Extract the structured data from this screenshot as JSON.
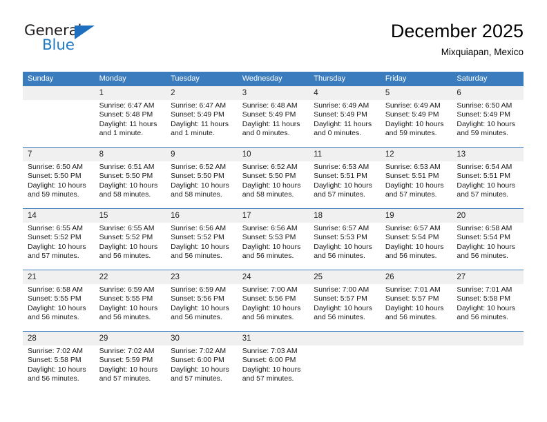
{
  "brand": {
    "name_top": "General",
    "name_bottom": "Blue",
    "triangle_color": "#1f6fc0",
    "blue_color": "#1f7ac6"
  },
  "header": {
    "title": "December 2025",
    "subtitle": "Mixquiapan, Mexico"
  },
  "theme": {
    "header_bg": "#3b7cbf",
    "header_text": "#ffffff",
    "daynum_bg": "#f0f0f0",
    "rule_color": "#3b7cbf"
  },
  "weekday_headers": [
    "Sunday",
    "Monday",
    "Tuesday",
    "Wednesday",
    "Thursday",
    "Friday",
    "Saturday"
  ],
  "labels": {
    "sunrise": "Sunrise:",
    "sunset": "Sunset:",
    "daylight": "Daylight:"
  },
  "weeks": [
    [
      {
        "day": "",
        "sunrise": "",
        "sunset": "",
        "daylight_1": "",
        "daylight_2": ""
      },
      {
        "day": "1",
        "sunrise": "Sunrise: 6:47 AM",
        "sunset": "Sunset: 5:48 PM",
        "daylight_1": "Daylight: 11 hours",
        "daylight_2": "and 1 minute."
      },
      {
        "day": "2",
        "sunrise": "Sunrise: 6:47 AM",
        "sunset": "Sunset: 5:49 PM",
        "daylight_1": "Daylight: 11 hours",
        "daylight_2": "and 1 minute."
      },
      {
        "day": "3",
        "sunrise": "Sunrise: 6:48 AM",
        "sunset": "Sunset: 5:49 PM",
        "daylight_1": "Daylight: 11 hours",
        "daylight_2": "and 0 minutes."
      },
      {
        "day": "4",
        "sunrise": "Sunrise: 6:49 AM",
        "sunset": "Sunset: 5:49 PM",
        "daylight_1": "Daylight: 11 hours",
        "daylight_2": "and 0 minutes."
      },
      {
        "day": "5",
        "sunrise": "Sunrise: 6:49 AM",
        "sunset": "Sunset: 5:49 PM",
        "daylight_1": "Daylight: 10 hours",
        "daylight_2": "and 59 minutes."
      },
      {
        "day": "6",
        "sunrise": "Sunrise: 6:50 AM",
        "sunset": "Sunset: 5:49 PM",
        "daylight_1": "Daylight: 10 hours",
        "daylight_2": "and 59 minutes."
      }
    ],
    [
      {
        "day": "7",
        "sunrise": "Sunrise: 6:50 AM",
        "sunset": "Sunset: 5:50 PM",
        "daylight_1": "Daylight: 10 hours",
        "daylight_2": "and 59 minutes."
      },
      {
        "day": "8",
        "sunrise": "Sunrise: 6:51 AM",
        "sunset": "Sunset: 5:50 PM",
        "daylight_1": "Daylight: 10 hours",
        "daylight_2": "and 58 minutes."
      },
      {
        "day": "9",
        "sunrise": "Sunrise: 6:52 AM",
        "sunset": "Sunset: 5:50 PM",
        "daylight_1": "Daylight: 10 hours",
        "daylight_2": "and 58 minutes."
      },
      {
        "day": "10",
        "sunrise": "Sunrise: 6:52 AM",
        "sunset": "Sunset: 5:50 PM",
        "daylight_1": "Daylight: 10 hours",
        "daylight_2": "and 58 minutes."
      },
      {
        "day": "11",
        "sunrise": "Sunrise: 6:53 AM",
        "sunset": "Sunset: 5:51 PM",
        "daylight_1": "Daylight: 10 hours",
        "daylight_2": "and 57 minutes."
      },
      {
        "day": "12",
        "sunrise": "Sunrise: 6:53 AM",
        "sunset": "Sunset: 5:51 PM",
        "daylight_1": "Daylight: 10 hours",
        "daylight_2": "and 57 minutes."
      },
      {
        "day": "13",
        "sunrise": "Sunrise: 6:54 AM",
        "sunset": "Sunset: 5:51 PM",
        "daylight_1": "Daylight: 10 hours",
        "daylight_2": "and 57 minutes."
      }
    ],
    [
      {
        "day": "14",
        "sunrise": "Sunrise: 6:55 AM",
        "sunset": "Sunset: 5:52 PM",
        "daylight_1": "Daylight: 10 hours",
        "daylight_2": "and 57 minutes."
      },
      {
        "day": "15",
        "sunrise": "Sunrise: 6:55 AM",
        "sunset": "Sunset: 5:52 PM",
        "daylight_1": "Daylight: 10 hours",
        "daylight_2": "and 56 minutes."
      },
      {
        "day": "16",
        "sunrise": "Sunrise: 6:56 AM",
        "sunset": "Sunset: 5:52 PM",
        "daylight_1": "Daylight: 10 hours",
        "daylight_2": "and 56 minutes."
      },
      {
        "day": "17",
        "sunrise": "Sunrise: 6:56 AM",
        "sunset": "Sunset: 5:53 PM",
        "daylight_1": "Daylight: 10 hours",
        "daylight_2": "and 56 minutes."
      },
      {
        "day": "18",
        "sunrise": "Sunrise: 6:57 AM",
        "sunset": "Sunset: 5:53 PM",
        "daylight_1": "Daylight: 10 hours",
        "daylight_2": "and 56 minutes."
      },
      {
        "day": "19",
        "sunrise": "Sunrise: 6:57 AM",
        "sunset": "Sunset: 5:54 PM",
        "daylight_1": "Daylight: 10 hours",
        "daylight_2": "and 56 minutes."
      },
      {
        "day": "20",
        "sunrise": "Sunrise: 6:58 AM",
        "sunset": "Sunset: 5:54 PM",
        "daylight_1": "Daylight: 10 hours",
        "daylight_2": "and 56 minutes."
      }
    ],
    [
      {
        "day": "21",
        "sunrise": "Sunrise: 6:58 AM",
        "sunset": "Sunset: 5:55 PM",
        "daylight_1": "Daylight: 10 hours",
        "daylight_2": "and 56 minutes."
      },
      {
        "day": "22",
        "sunrise": "Sunrise: 6:59 AM",
        "sunset": "Sunset: 5:55 PM",
        "daylight_1": "Daylight: 10 hours",
        "daylight_2": "and 56 minutes."
      },
      {
        "day": "23",
        "sunrise": "Sunrise: 6:59 AM",
        "sunset": "Sunset: 5:56 PM",
        "daylight_1": "Daylight: 10 hours",
        "daylight_2": "and 56 minutes."
      },
      {
        "day": "24",
        "sunrise": "Sunrise: 7:00 AM",
        "sunset": "Sunset: 5:56 PM",
        "daylight_1": "Daylight: 10 hours",
        "daylight_2": "and 56 minutes."
      },
      {
        "day": "25",
        "sunrise": "Sunrise: 7:00 AM",
        "sunset": "Sunset: 5:57 PM",
        "daylight_1": "Daylight: 10 hours",
        "daylight_2": "and 56 minutes."
      },
      {
        "day": "26",
        "sunrise": "Sunrise: 7:01 AM",
        "sunset": "Sunset: 5:57 PM",
        "daylight_1": "Daylight: 10 hours",
        "daylight_2": "and 56 minutes."
      },
      {
        "day": "27",
        "sunrise": "Sunrise: 7:01 AM",
        "sunset": "Sunset: 5:58 PM",
        "daylight_1": "Daylight: 10 hours",
        "daylight_2": "and 56 minutes."
      }
    ],
    [
      {
        "day": "28",
        "sunrise": "Sunrise: 7:02 AM",
        "sunset": "Sunset: 5:58 PM",
        "daylight_1": "Daylight: 10 hours",
        "daylight_2": "and 56 minutes."
      },
      {
        "day": "29",
        "sunrise": "Sunrise: 7:02 AM",
        "sunset": "Sunset: 5:59 PM",
        "daylight_1": "Daylight: 10 hours",
        "daylight_2": "and 57 minutes."
      },
      {
        "day": "30",
        "sunrise": "Sunrise: 7:02 AM",
        "sunset": "Sunset: 6:00 PM",
        "daylight_1": "Daylight: 10 hours",
        "daylight_2": "and 57 minutes."
      },
      {
        "day": "31",
        "sunrise": "Sunrise: 7:03 AM",
        "sunset": "Sunset: 6:00 PM",
        "daylight_1": "Daylight: 10 hours",
        "daylight_2": "and 57 minutes."
      },
      {
        "day": "",
        "sunrise": "",
        "sunset": "",
        "daylight_1": "",
        "daylight_2": ""
      },
      {
        "day": "",
        "sunrise": "",
        "sunset": "",
        "daylight_1": "",
        "daylight_2": ""
      },
      {
        "day": "",
        "sunrise": "",
        "sunset": "",
        "daylight_1": "",
        "daylight_2": ""
      }
    ]
  ]
}
